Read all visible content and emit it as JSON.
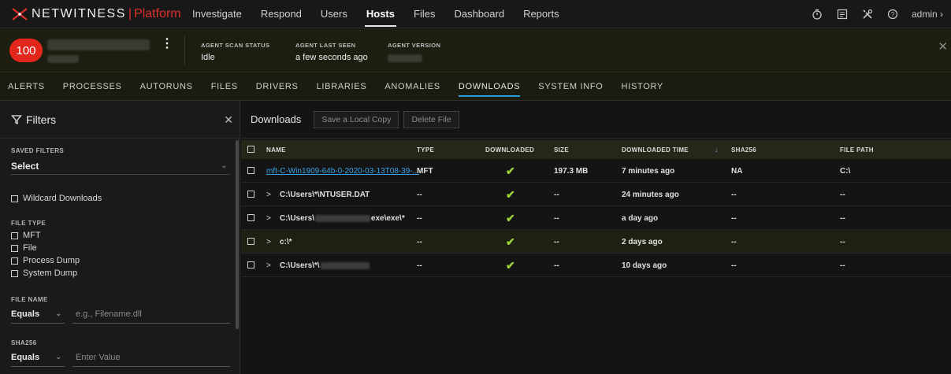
{
  "topnav": {
    "brand_name": "NETWITNESS",
    "brand_sep": "|",
    "brand_sub": "Platform",
    "items": [
      {
        "label": "Investigate"
      },
      {
        "label": "Respond"
      },
      {
        "label": "Users"
      },
      {
        "label": "Hosts"
      },
      {
        "label": "Files"
      },
      {
        "label": "Dashboard"
      },
      {
        "label": "Reports"
      }
    ],
    "active": "Hosts",
    "right_icons": [
      "timer-icon",
      "settings-panel-icon",
      "tools-icon",
      "help-icon"
    ],
    "admin_label": "admin",
    "admin_chevron": "›"
  },
  "host": {
    "risk_score": "100",
    "stats": [
      {
        "label": "AGENT SCAN STATUS",
        "value": "Idle"
      },
      {
        "label": "AGENT LAST SEEN",
        "value": "a few seconds ago"
      },
      {
        "label": "AGENT VERSION",
        "value": ""
      }
    ]
  },
  "subtabs": {
    "items": [
      "ALERTS",
      "PROCESSES",
      "AUTORUNS",
      "FILES",
      "DRIVERS",
      "LIBRARIES",
      "ANOMALIES",
      "DOWNLOADS",
      "SYSTEM INFO",
      "HISTORY"
    ],
    "active": "DOWNLOADS"
  },
  "filters": {
    "title": "Filters",
    "saved_filters_label": "SAVED FILTERS",
    "saved_filters_value": "Select",
    "wildcard_label": "Wildcard Downloads",
    "file_type_label": "FILE TYPE",
    "file_types": [
      "MFT",
      "File",
      "Process Dump",
      "System Dump"
    ],
    "file_name_label": "FILE NAME",
    "file_name_op": "Equals",
    "file_name_placeholder": "e.g., Filename.dll",
    "sha256_label": "SHA256",
    "sha256_op": "Equals",
    "sha256_placeholder": "Enter Value"
  },
  "downloads": {
    "title": "Downloads",
    "save_copy_label": "Save a Local Copy",
    "delete_label": "Delete File",
    "columns": [
      "NAME",
      "TYPE",
      "DOWNLOADED",
      "SIZE",
      "DOWNLOADED TIME",
      "SHA256",
      "FILE PATH"
    ],
    "sort_column": "DOWNLOADED TIME",
    "sort_direction": "descending",
    "rows": [
      {
        "name": "mft-C-Win1909-64b-0-2020-03-13T08-39-...",
        "type": "MFT",
        "downloaded": true,
        "size": "197.3 MB",
        "time": "7 minutes ago",
        "sha256": "NA",
        "path": "C:\\",
        "link": true,
        "expandable": false
      },
      {
        "name": "C:\\Users\\*\\NTUSER.DAT",
        "type": "--",
        "downloaded": true,
        "size": "--",
        "time": "24 minutes ago",
        "sha256": "--",
        "path": "--",
        "expandable": true
      },
      {
        "name_prefix": "C:\\Users\\",
        "name_suffix": "exe\\exe\\*",
        "type": "--",
        "downloaded": true,
        "size": "--",
        "time": "a day ago",
        "sha256": "--",
        "path": "--",
        "expandable": true,
        "redacted": true
      },
      {
        "name": "c:\\*",
        "type": "--",
        "downloaded": true,
        "size": "--",
        "time": "2 days ago",
        "sha256": "--",
        "path": "--",
        "expandable": true,
        "selected": true
      },
      {
        "name_prefix": "C:\\Users\\*\\",
        "name_suffix": "",
        "type": "--",
        "downloaded": true,
        "size": "--",
        "time": "10 days ago",
        "sha256": "--",
        "path": "--",
        "expandable": true,
        "redacted": true
      }
    ]
  },
  "colors": {
    "accent_blue": "#2d9ad8",
    "risk_red": "#e3261c",
    "brand_red": "#e0302a",
    "check_green": "#9bd436",
    "link_blue": "#3aa2e8"
  }
}
